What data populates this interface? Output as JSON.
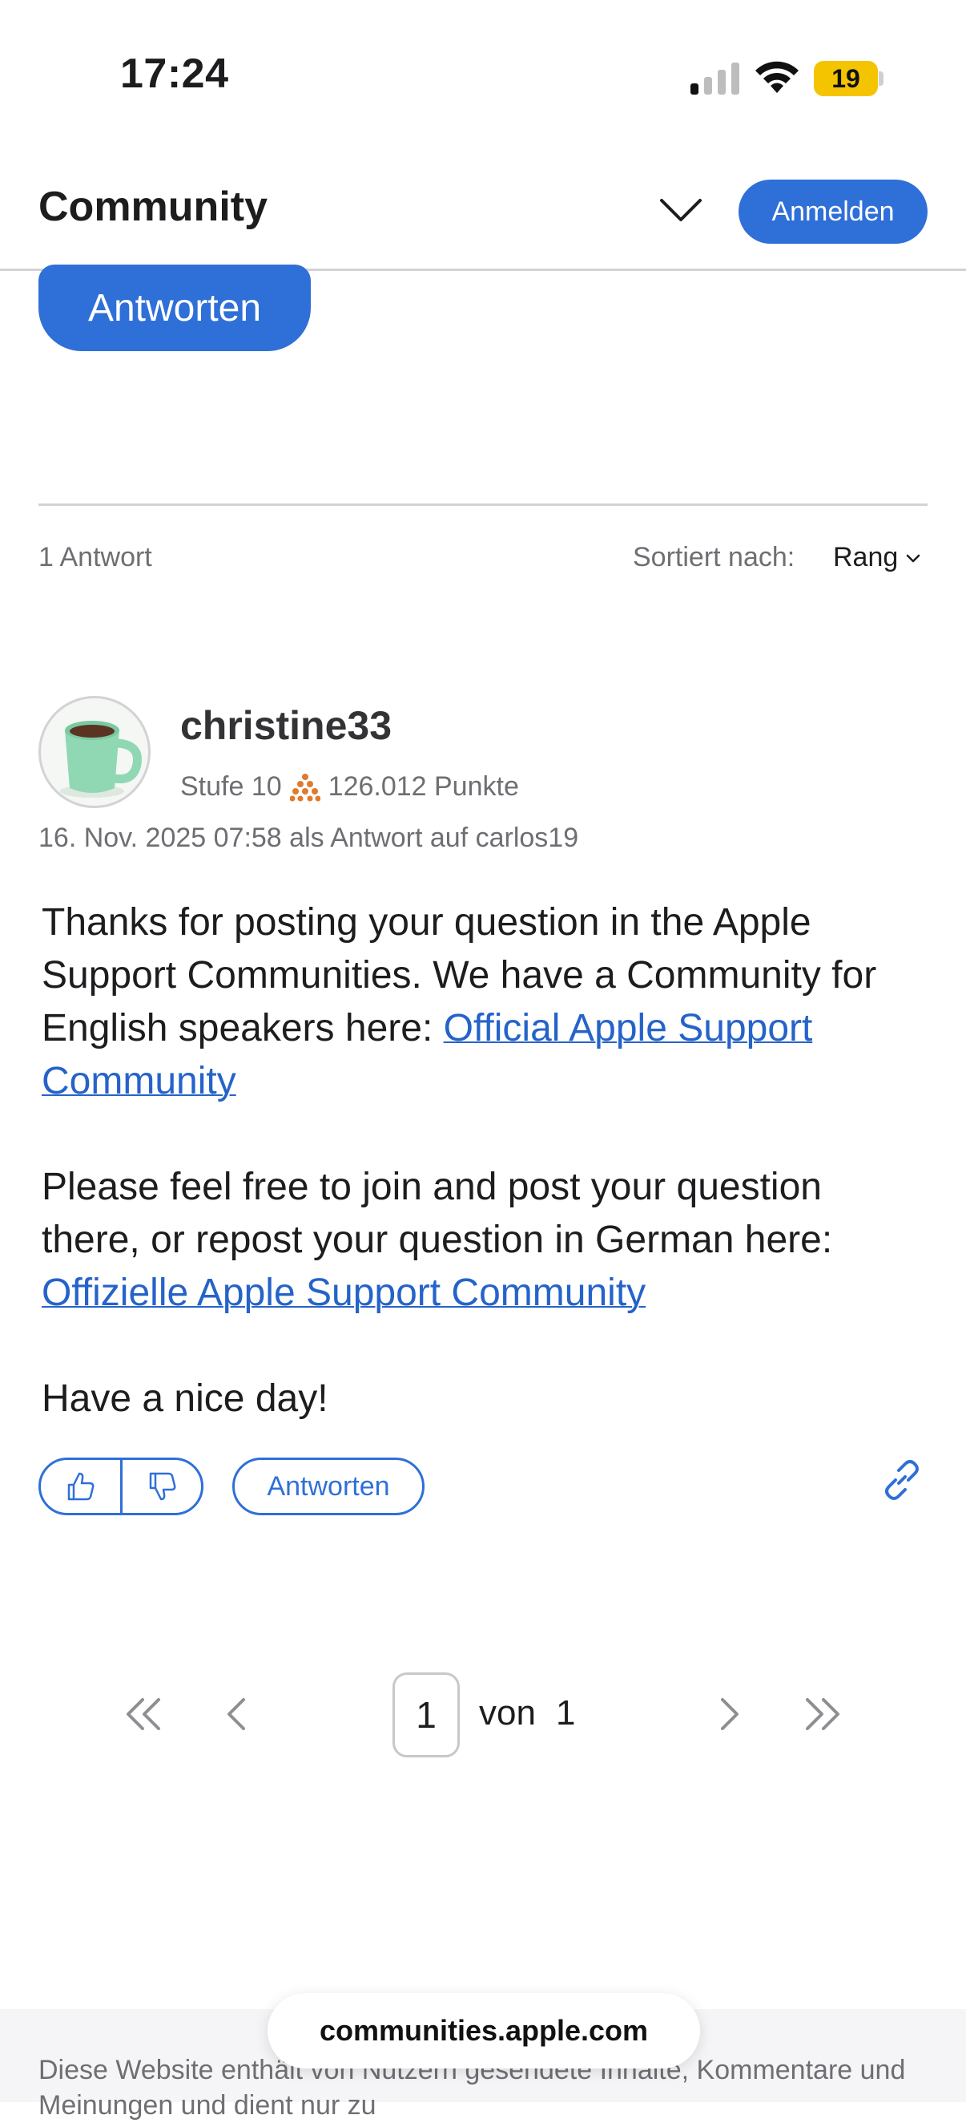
{
  "status_bar": {
    "time": "17:24",
    "battery": "19"
  },
  "header": {
    "title": "Community",
    "login_label": "Anmelden"
  },
  "thread": {
    "reply_button_label": "Antworten",
    "answer_count": "1 Antwort",
    "sort_label": "Sortiert nach:",
    "sort_value": "Rang"
  },
  "post": {
    "author": "christine33",
    "level": "Stufe 10",
    "points": "126.012 Punkte",
    "timestamp": "16. Nov. 2025 07:58 als Antwort auf carlos19",
    "paragraph1_text": "Thanks for posting your question in the Apple Support Communities. We have a Community for English speakers here: ",
    "paragraph1_link": "Official Apple Support Community",
    "paragraph2_text": "Please feel free to join and post your question there, or repost your question in German here: ",
    "paragraph2_link": "Offizielle Apple Support Community",
    "paragraph3_text": "Have a nice day!",
    "reply_label": "Antworten"
  },
  "pagination": {
    "current": "1",
    "of_label": "von",
    "total": "1"
  },
  "browser": {
    "url": "communities.apple.com"
  },
  "footer": {
    "text": "Diese Website enthält von Nutzern gesendete Inhalte, Kommentare und Meinungen und dient nur zu"
  },
  "colors": {
    "accent": "#2f6fd8",
    "link": "#2563c9",
    "battery": "#f5c400",
    "level_icon": "#e07a2c"
  },
  "icons": [
    "signal-icon",
    "wifi-icon",
    "chevron-down-icon",
    "thumbs-up-icon",
    "thumbs-down-icon",
    "link-icon",
    "first-page-icon",
    "prev-page-icon",
    "next-page-icon",
    "last-page-icon"
  ]
}
